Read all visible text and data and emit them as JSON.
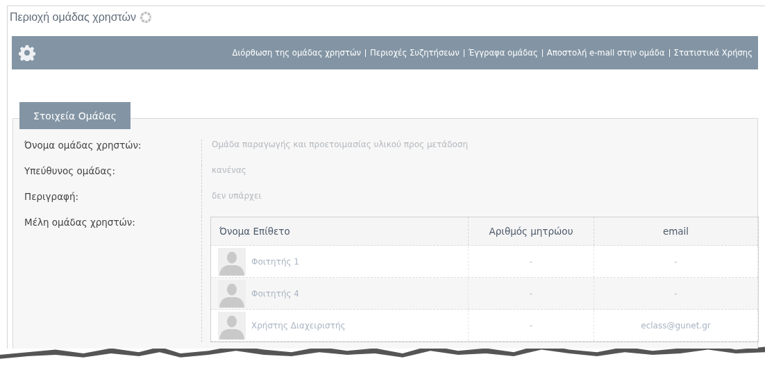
{
  "page_title": "Περιοχή ομάδας χρηστών",
  "toolbar": {
    "links": [
      "Διόρθωση της ομάδας χρηστών",
      "Περιοχές Συζητήσεων",
      "Έγγραφα ομάδας",
      "Αποστολή e-mail στην ομάδα",
      "Στατιστικά Χρήσης"
    ]
  },
  "section": {
    "title": "Στοιχεία Ομάδας",
    "fields": [
      {
        "label": "Όνομα ομάδας χρηστών:",
        "value": "Ομάδα παραγωγής και προετοιμασίας υλικού προς μετάδοση"
      },
      {
        "label": "Υπεύθυνος ομάδας:",
        "value": "κανένας"
      },
      {
        "label": "Περιγραφή:",
        "value": "δεν υπάρχει"
      }
    ],
    "members_label": "Μέλη ομάδας χρηστών:",
    "members_table": {
      "columns": [
        "Όνομα Επίθετο",
        "Αριθμός μητρώου",
        "email"
      ],
      "rows": [
        {
          "name": "Φοιτητής 1",
          "registry_number": "-",
          "email": "-"
        },
        {
          "name": "Φοιτητής 4",
          "registry_number": "-",
          "email": "-"
        },
        {
          "name": "Χρήστης Διαχειριστής",
          "registry_number": "-",
          "email": "eclass@gunet.gr"
        }
      ]
    }
  }
}
